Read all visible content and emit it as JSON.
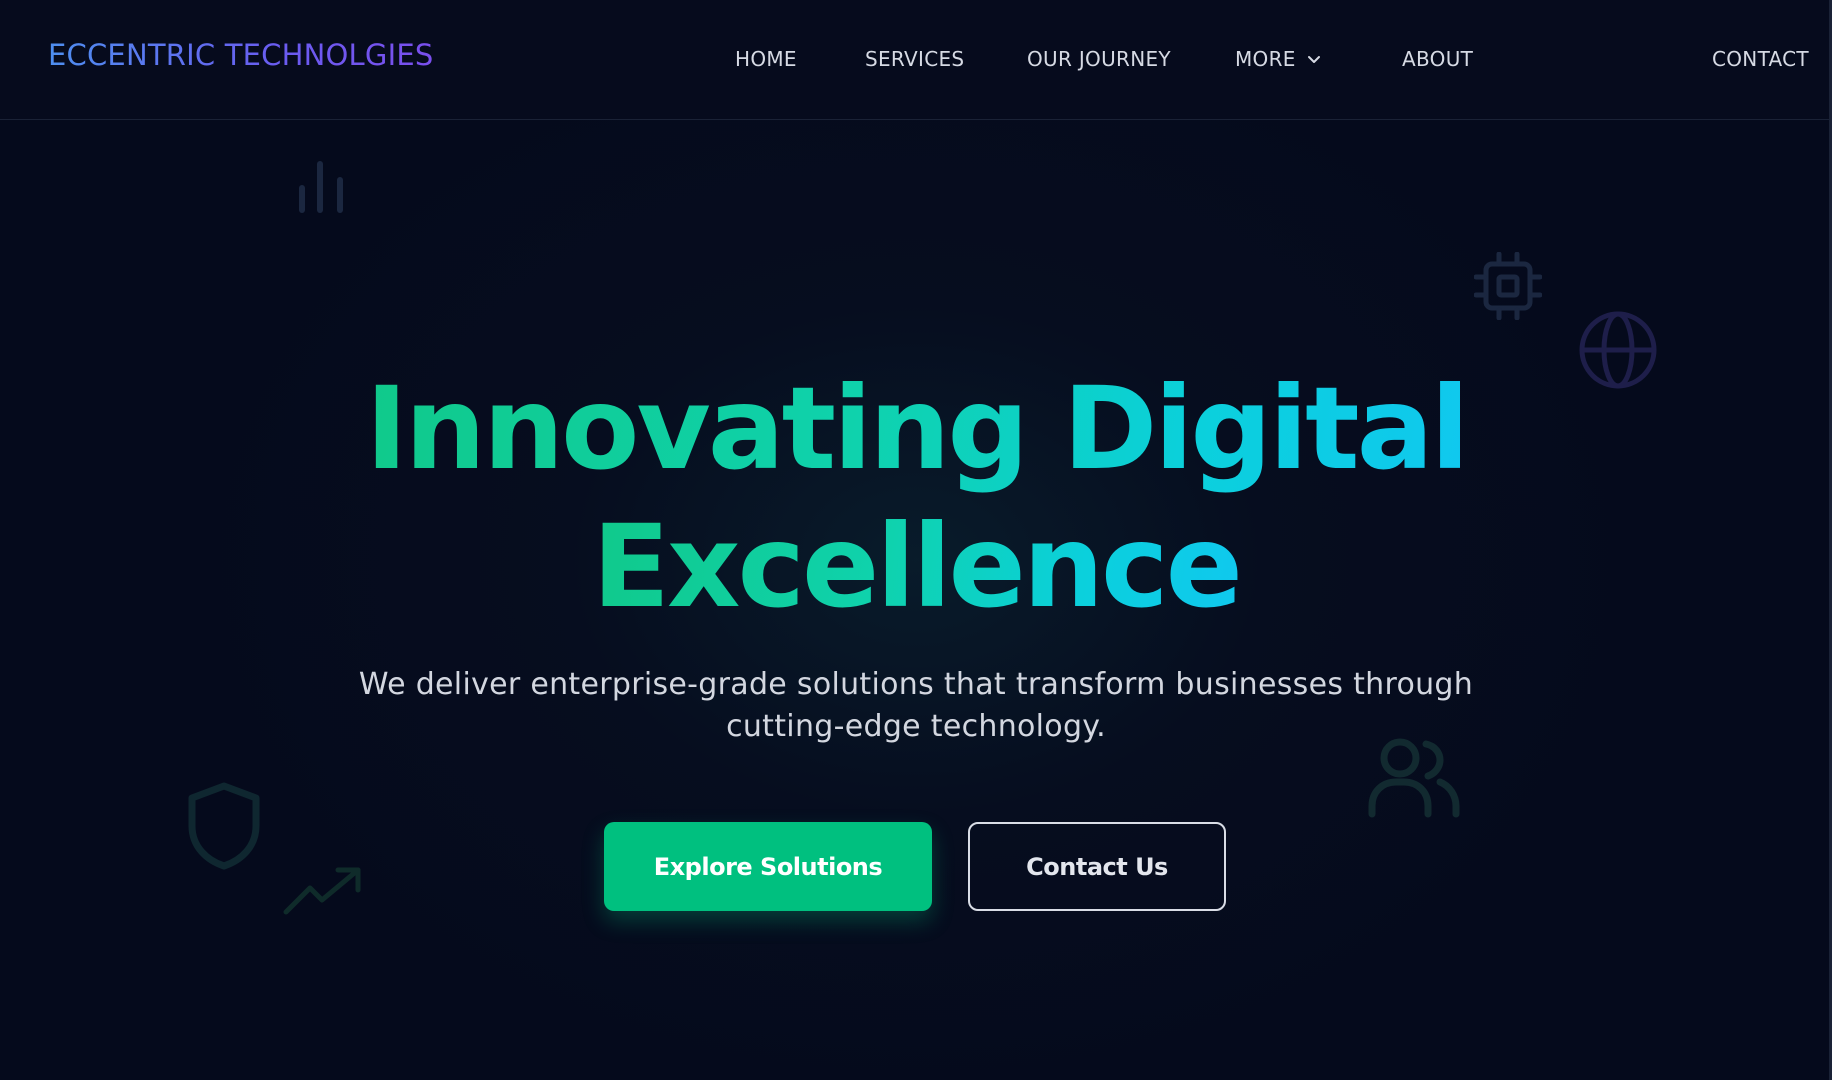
{
  "brand": {
    "name": "ECCENTRIC TECHNOLGIES"
  },
  "nav": {
    "items": [
      {
        "label": "HOME"
      },
      {
        "label": "SERVICES"
      },
      {
        "label": "OUR JOURNEY"
      },
      {
        "label": "MORE"
      },
      {
        "label": "ABOUT"
      },
      {
        "label": "CONTACT"
      }
    ]
  },
  "hero": {
    "title_line1": "Innovating Digital",
    "title_line2": "Excellence",
    "subtitle_line1": "We deliver enterprise-grade solutions that transform businesses through",
    "subtitle_line2": "cutting-edge technology.",
    "primary_cta": "Explore Solutions",
    "secondary_cta": "Contact Us"
  },
  "decor_icons": [
    "bar-chart-icon",
    "cpu-chip-icon",
    "globe-icon",
    "users-icon",
    "shield-icon",
    "trending-up-icon"
  ],
  "colors": {
    "background": "#050a1c",
    "accent_green": "#00c07f",
    "title_gradient_start": "#10c98a",
    "title_gradient_end": "#10c8ef",
    "brand_gradient_start": "#4e8ff0",
    "brand_gradient_end": "#7a4fee"
  }
}
